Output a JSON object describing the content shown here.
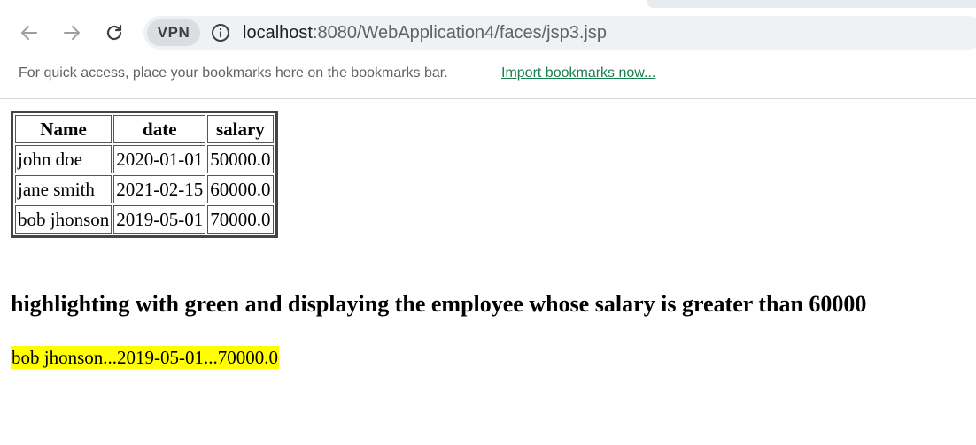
{
  "browser": {
    "vpn_label": "VPN",
    "url_host": "localhost",
    "url_rest": ":8080/WebApplication4/faces/jsp3.jsp",
    "bookmarks_text": "For quick access, place your bookmarks here on the bookmarks bar.",
    "bookmarks_link": "Import bookmarks now..."
  },
  "table": {
    "headers": [
      "Name",
      "date",
      "salary"
    ],
    "rows": [
      [
        "john doe",
        "2020-01-01",
        "50000.0"
      ],
      [
        "jane smith",
        "2021-02-15",
        "60000.0"
      ],
      [
        "bob jhonson",
        "2019-05-01",
        "70000.0"
      ]
    ]
  },
  "heading": "highlighting with green and displaying the employee whose salary is greater than 60000",
  "highlighted_result": "bob jhonson...2019-05-01...70000.0",
  "colors": {
    "highlight": "#ffff00",
    "link": "#1a7f4e"
  }
}
